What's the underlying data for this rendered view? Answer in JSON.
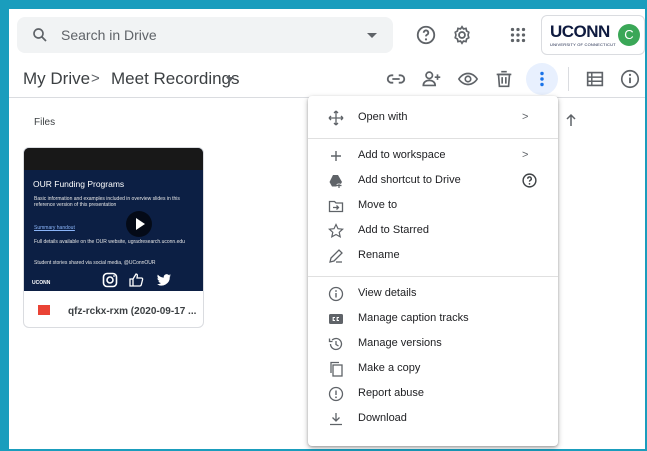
{
  "search": {
    "placeholder": "Search in Drive"
  },
  "account": {
    "org_logo_text": "UCONN",
    "org_logo_subtext": "UNIVERSITY OF CONNECTICUT",
    "avatar_initial": "C"
  },
  "breadcrumb": {
    "root": "My Drive",
    "separator": ">",
    "current": "Meet Recordings"
  },
  "files": {
    "label": "Files"
  },
  "file_card": {
    "name": "qfz-rckx-rxm (2020-09-17 ...",
    "thumbnail": {
      "title": "OUR Funding Programs",
      "bullets": [
        "Basic information and examples included in overview slides in this reference version of this presentation",
        "Summary handout",
        "Full details available on the OUR website, ugradresearch.uconn.edu",
        "Student stories shared via social media, @UConnOUR"
      ],
      "brand": "UCONN"
    }
  },
  "context_menu": {
    "items": [
      {
        "label": "Open with",
        "icon": "open-with-icon",
        "submenu": true
      },
      {
        "label": "Add to workspace",
        "icon": "plus-icon",
        "submenu": true
      },
      {
        "label": "Add shortcut to Drive",
        "icon": "add-shortcut-icon",
        "help": true
      },
      {
        "label": "Move to",
        "icon": "move-to-icon"
      },
      {
        "label": "Add to Starred",
        "icon": "star-icon"
      },
      {
        "label": "Rename",
        "icon": "pencil-icon"
      },
      {
        "label": "View details",
        "icon": "info-icon"
      },
      {
        "label": "Manage caption tracks",
        "icon": "cc-icon"
      },
      {
        "label": "Manage versions",
        "icon": "history-icon"
      },
      {
        "label": "Make a copy",
        "icon": "copy-icon"
      },
      {
        "label": "Report abuse",
        "icon": "report-icon"
      },
      {
        "label": "Download",
        "icon": "download-icon"
      }
    ],
    "chevron": ">"
  },
  "colors": {
    "frame": "#1a9dbd",
    "accent_light": "#e8f0fe",
    "video_red": "#ea4335",
    "avatar_green": "#3aa757"
  }
}
